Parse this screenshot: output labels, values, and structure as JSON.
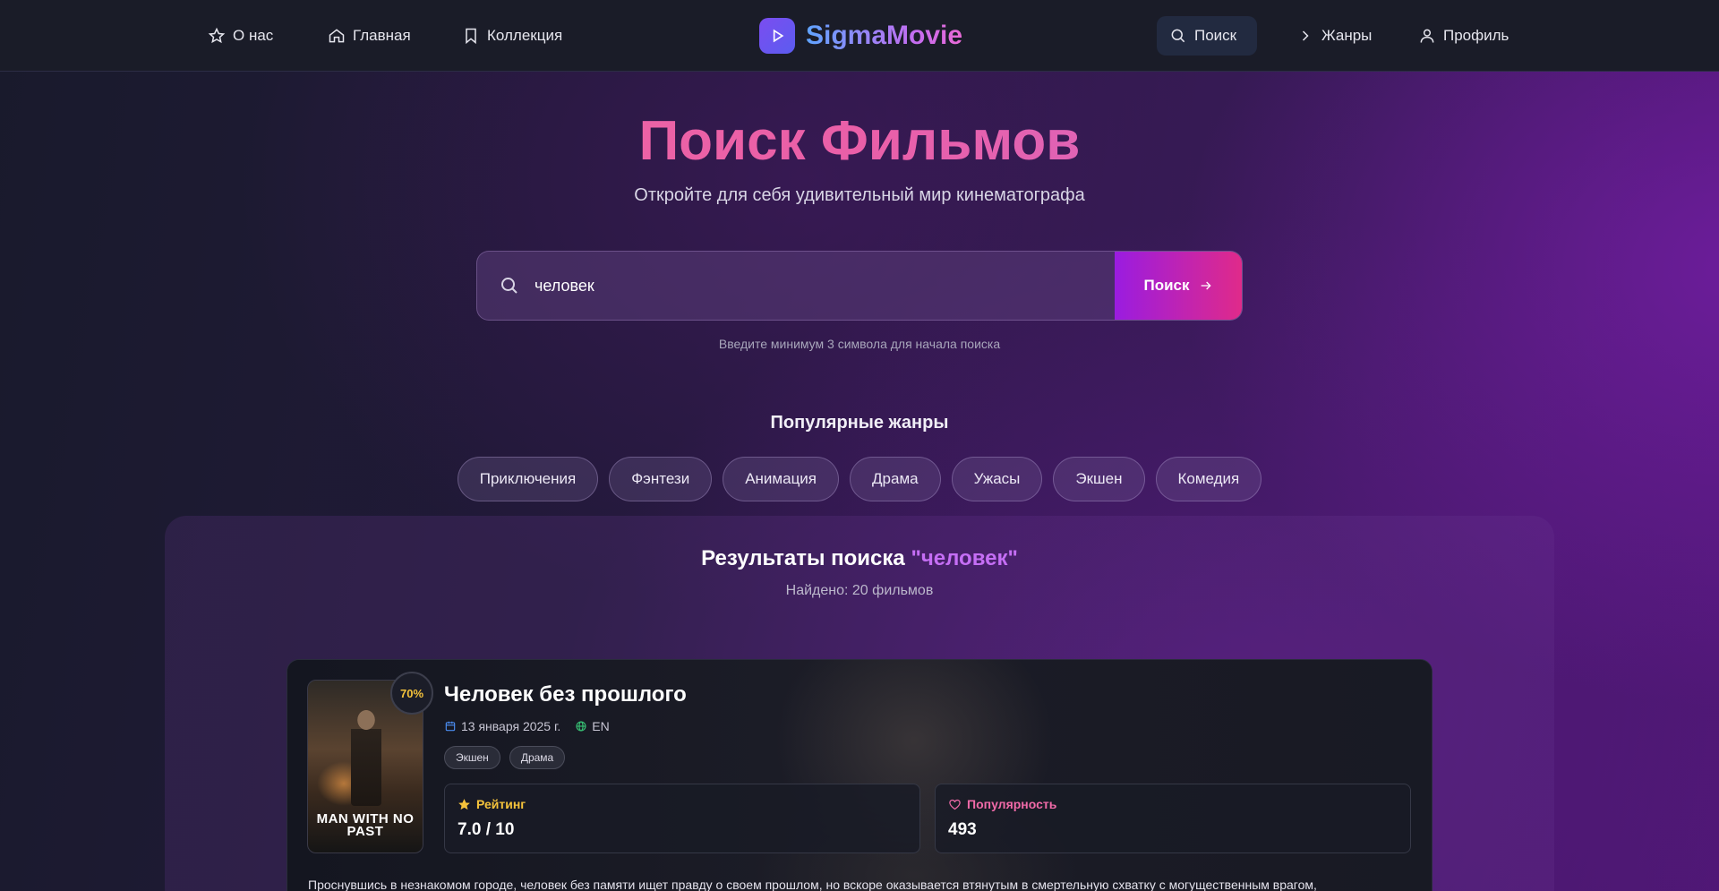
{
  "nav": {
    "about": "О нас",
    "home": "Главная",
    "collection": "Коллекция",
    "search": "Поиск",
    "genres": "Жанры",
    "profile": "Профиль"
  },
  "brand": {
    "name": "SigmaMovie"
  },
  "hero": {
    "title": "Поиск Фильмов",
    "subtitle": "Откройте для себя удивительный мир кинематографа"
  },
  "search": {
    "value": "человек",
    "button_label": "Поиск",
    "hint": "Введите минимум 3 символа для начала поиска"
  },
  "popular_genres": {
    "title": "Популярные жанры",
    "items": [
      "Приключения",
      "Фэнтези",
      "Анимация",
      "Драма",
      "Ужасы",
      "Экшен",
      "Комедия"
    ]
  },
  "results": {
    "title_prefix": "Результаты поиска ",
    "query_quoted": "\"человек\"",
    "count": "Найдено: 20 фильмов"
  },
  "movie": {
    "score": "70%",
    "title": "Человек без прошлого",
    "date": "13 января 2025 г.",
    "language": "EN",
    "tags": [
      "Экшен",
      "Драма"
    ],
    "poster_title": "MAN WITH NO PAST",
    "rating_label": "Рейтинг",
    "rating_value": "7.0 / 10",
    "popularity_label": "Популярность",
    "popularity_value": "493",
    "description": "Проснувшись в незнакомом городе, человек без памяти ищет правду о своем прошлом, но вскоре оказывается втянутым в смертельную схватку с могущественным врагом,"
  },
  "colors": {
    "accent_pink": "#e02a8a",
    "accent_purple": "#9a1ce0",
    "rating_star": "#f5c33b",
    "popularity_heart": "#f06aa8"
  }
}
